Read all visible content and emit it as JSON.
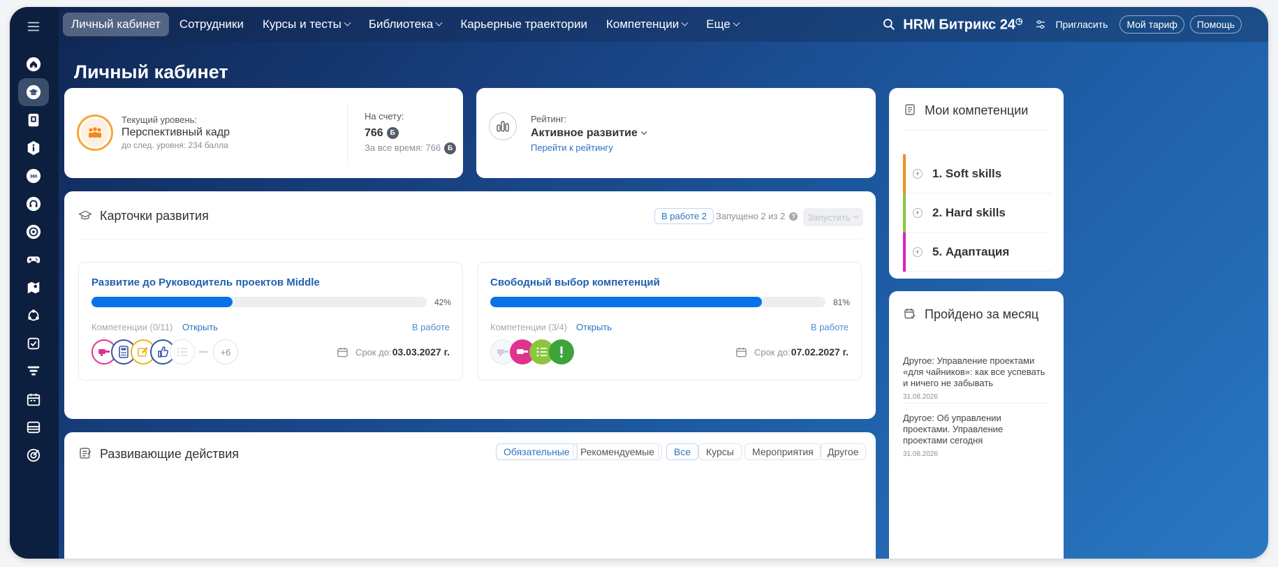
{
  "topbar": {
    "nav": [
      {
        "label": "Личный кабинет",
        "active": true,
        "dropdown": false
      },
      {
        "label": "Сотрудники",
        "active": false,
        "dropdown": false
      },
      {
        "label": "Курсы и тесты",
        "active": false,
        "dropdown": true
      },
      {
        "label": "Библиотека",
        "active": false,
        "dropdown": true
      },
      {
        "label": "Карьерные траектории",
        "active": false,
        "dropdown": false
      },
      {
        "label": "Компетенции",
        "active": false,
        "dropdown": true
      },
      {
        "label": "Еще",
        "active": false,
        "dropdown": true
      }
    ],
    "brand": "HRM Битрикс",
    "brand_num": "24",
    "invite": "Пригласить",
    "tariff": "Мой тариф",
    "help": "Помощь"
  },
  "page_title": "Личный кабинет",
  "level_card": {
    "label": "Текущий уровень:",
    "value": "Перспективный кадр",
    "next": "до след. уровня: 234 балла",
    "account_label": "На счету:",
    "account_value": "766",
    "badge": "Б",
    "total": "За все время: 766"
  },
  "rating_card": {
    "label": "Рейтинг:",
    "value": "Активное развитие",
    "link": "Перейти к рейтингу"
  },
  "dev_cards": {
    "title": "Карточки развития",
    "in_work": "В работе 2",
    "launched": "Запущено 2 из 2",
    "launch_button": "Запустить",
    "items": [
      {
        "title": "Развитие до Руководитель проектов Middle",
        "progress": 42,
        "progress_label": "42%",
        "competencies": "Компетенции (0/11)",
        "open": "Открыть",
        "status": "В работе",
        "deadline_label": "Срок до:",
        "deadline": "03.03.2027 г.",
        "extra": "+6"
      },
      {
        "title": "Свободный выбор компетенций",
        "progress": 81,
        "progress_label": "81%",
        "competencies": "Компетенции (3/4)",
        "open": "Открыть",
        "status": "В работе",
        "deadline_label": "Срок до:",
        "deadline": "07.02.2027 г."
      }
    ]
  },
  "actions": {
    "title": "Развивающие действия",
    "filters": [
      "Обязательные",
      "Рекомендуемые",
      "Все",
      "Курсы",
      "Мероприятия",
      "Другое"
    ]
  },
  "competencies": {
    "title": "Мои компетенции",
    "items": [
      {
        "label": "1. Soft skills",
        "color": "#f0901e"
      },
      {
        "label": "2. Hard skills",
        "color": "#8cc63f"
      },
      {
        "label": "5. Адаптация",
        "color": "#e020c8"
      }
    ]
  },
  "month": {
    "title": "Пройдено за месяц",
    "items": [
      {
        "text": "Другое: Управление проектами «для чайников»: как все успевать и ничего не забывать",
        "date": "31.08.2026"
      },
      {
        "text": "Другое: Об управлении проектами. Управление проектами сегодня",
        "date": "31.08.2026"
      }
    ]
  },
  "colors": {
    "accent": "#0a72e8",
    "link": "#2a72c4",
    "sidebar": "#0d1f3e"
  },
  "sidebar_icons": [
    "menu-icon",
    "home-icon",
    "graduation-icon",
    "book-icon",
    "info-icon",
    "360-icon",
    "headset-icon",
    "target-icon",
    "gamepad-icon",
    "map-icon",
    "process-icon",
    "checkbox-icon",
    "funnel-icon",
    "calendar-icon",
    "archive-icon",
    "goal-icon"
  ]
}
